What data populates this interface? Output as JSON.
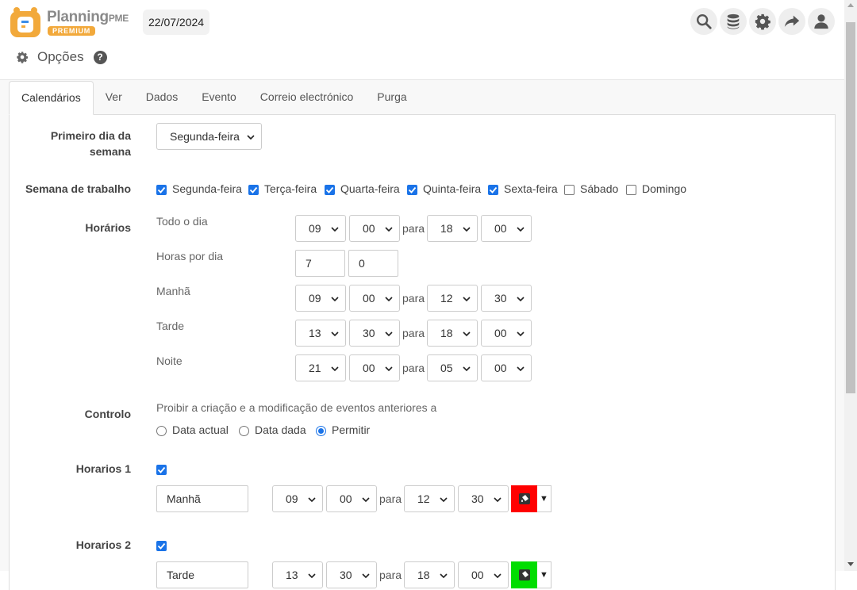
{
  "header": {
    "logo_name": "Planning",
    "logo_suffix": "PME",
    "logo_badge": "PREMIUM",
    "date": "22/07/2024",
    "icons": [
      "search-icon",
      "database-icon",
      "gear-icon",
      "share-icon",
      "user-icon"
    ]
  },
  "page": {
    "title": "Opções",
    "help_label": "?"
  },
  "tabs": [
    {
      "label": "Calendários",
      "active": true
    },
    {
      "label": "Ver"
    },
    {
      "label": "Dados"
    },
    {
      "label": "Evento"
    },
    {
      "label": "Correio electrónico"
    },
    {
      "label": "Purga"
    }
  ],
  "form": {
    "first_day": {
      "label_line1": "Primeiro dia da",
      "label_line2": "semana",
      "value": "Segunda-feira"
    },
    "work_week": {
      "label": "Semana de trabalho",
      "days": [
        {
          "name": "Segunda-feira",
          "checked": true
        },
        {
          "name": "Terça-feira",
          "checked": true
        },
        {
          "name": "Quarta-feira",
          "checked": true
        },
        {
          "name": "Quinta-feira",
          "checked": true
        },
        {
          "name": "Sexta-feira",
          "checked": true
        },
        {
          "name": "Sábado",
          "checked": false
        },
        {
          "name": "Domingo",
          "checked": false
        }
      ]
    },
    "schedules": {
      "label": "Horários",
      "to_word": "para",
      "all_day": {
        "label": "Todo o dia",
        "h1": "09",
        "m1": "00",
        "h2": "18",
        "m2": "00"
      },
      "hours_per_day": {
        "label": "Horas por dia",
        "hours": "7",
        "minutes": "0"
      },
      "morning": {
        "label": "Manhã",
        "h1": "09",
        "m1": "00",
        "h2": "12",
        "m2": "30"
      },
      "afternoon": {
        "label": "Tarde",
        "h1": "13",
        "m1": "30",
        "h2": "18",
        "m2": "00"
      },
      "night": {
        "label": "Noite",
        "h1": "21",
        "m1": "00",
        "h2": "05",
        "m2": "00"
      }
    },
    "control": {
      "label": "Controlo",
      "description": "Proibir a criação e a modificação de eventos anteriores a",
      "options": [
        {
          "label": "Data actual",
          "selected": false
        },
        {
          "label": "Data dada",
          "selected": false
        },
        {
          "label": "Permitir",
          "selected": true
        }
      ]
    },
    "slot1": {
      "label": "Horarios 1",
      "checked": true,
      "name": "Manhã",
      "h1": "09",
      "m1": "00",
      "to": "para",
      "h2": "12",
      "m2": "30",
      "color": "#ff0000"
    },
    "slot2": {
      "label": "Horarios 2",
      "checked": true,
      "name": "Tarde",
      "h1": "13",
      "m1": "30",
      "to": "para",
      "h2": "18",
      "m2": "00",
      "color": "#00dd00"
    }
  },
  "colors": {
    "accent": "#1a73e8",
    "logo_orange": "#f2a93b"
  }
}
